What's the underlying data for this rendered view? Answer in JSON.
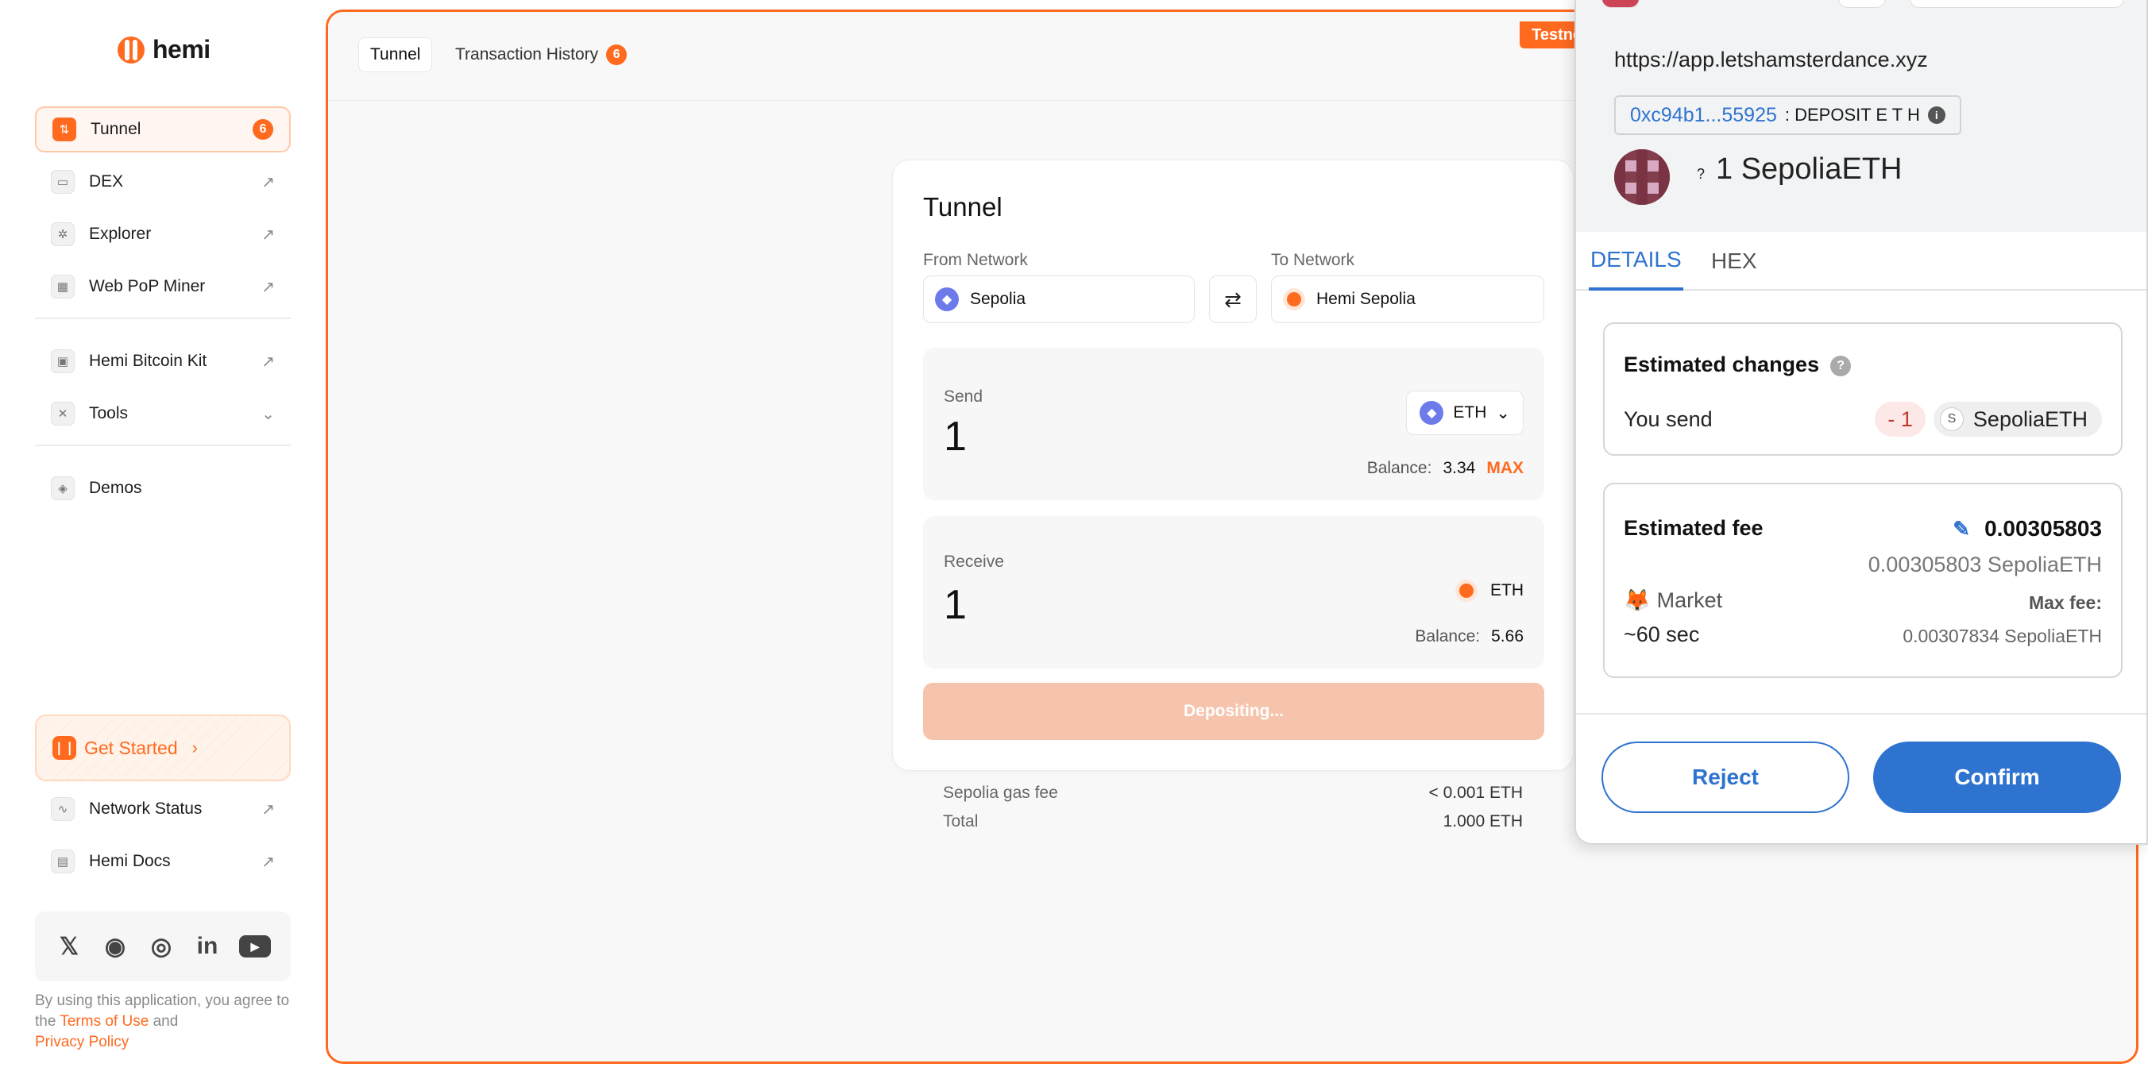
{
  "sidebar": {
    "logo_text": "hemi",
    "nav_top": [
      {
        "label": "Tunnel",
        "badge": "6",
        "active": true
      },
      {
        "label": "DEX"
      },
      {
        "label": "Explorer"
      },
      {
        "label": "Web PoP Miner"
      }
    ],
    "nav_mid": [
      {
        "label": "Hemi Bitcoin Kit"
      },
      {
        "label": "Tools"
      }
    ],
    "nav_demos": {
      "label": "Demos"
    },
    "get_started": "Get Started",
    "nav_bottom": [
      {
        "label": "Network Status"
      },
      {
        "label": "Hemi Docs"
      }
    ],
    "socials": [
      "X",
      "Discord",
      "GitHub",
      "LinkedIn",
      "YouTube"
    ],
    "legal": {
      "prefix": "By using this application, you agree to the",
      "terms": "Terms of Use",
      "and": "and",
      "privacy": "Privacy Policy"
    }
  },
  "main": {
    "testnet_label": "Testnet",
    "tabs": [
      {
        "label": "Tunnel"
      },
      {
        "label": "Transaction History",
        "badge": "6"
      }
    ],
    "card": {
      "title": "Tunnel",
      "from_label": "From Network",
      "from_value": "Sepolia",
      "to_label": "To Network",
      "to_value": "Hemi Sepolia",
      "send": {
        "label": "Send",
        "amount": "1",
        "token": "ETH",
        "balance_label": "Balance:",
        "balance": "3.34",
        "max": "MAX"
      },
      "receive": {
        "label": "Receive",
        "amount": "1",
        "token": "ETH",
        "balance_label": "Balance:",
        "balance": "5.66"
      },
      "deposit_button": "Depositing..."
    },
    "fees": [
      {
        "label": "Sepolia gas fee",
        "value": "< 0.001 ETH"
      },
      {
        "label": "Total",
        "value": "1.000 ETH"
      }
    ]
  },
  "metamask": {
    "origin": "https://app.letshamsterdance.xyz",
    "address": "0xc94b1...55925",
    "method": ": DEPOSIT E T H",
    "amount_q": "?",
    "amount": "1 SepoliaETH",
    "tabs": [
      "DETAILS",
      "HEX"
    ],
    "estimated_changes": {
      "title": "Estimated changes",
      "you_send": "You send",
      "delta": "- 1",
      "token": "SepoliaETH"
    },
    "estimated_fee": {
      "title": "Estimated fee",
      "value": "0.00305803",
      "value_full": "0.00305803 SepoliaETH",
      "market": "Market",
      "time": "~60 sec",
      "max_fee_label": "Max fee:",
      "max_fee": "0.00307834 SepoliaETH"
    },
    "reject": "Reject",
    "confirm": "Confirm"
  },
  "colors": {
    "brand_orange": "#ff6a1f",
    "metamask_blue": "#2f73d0"
  }
}
